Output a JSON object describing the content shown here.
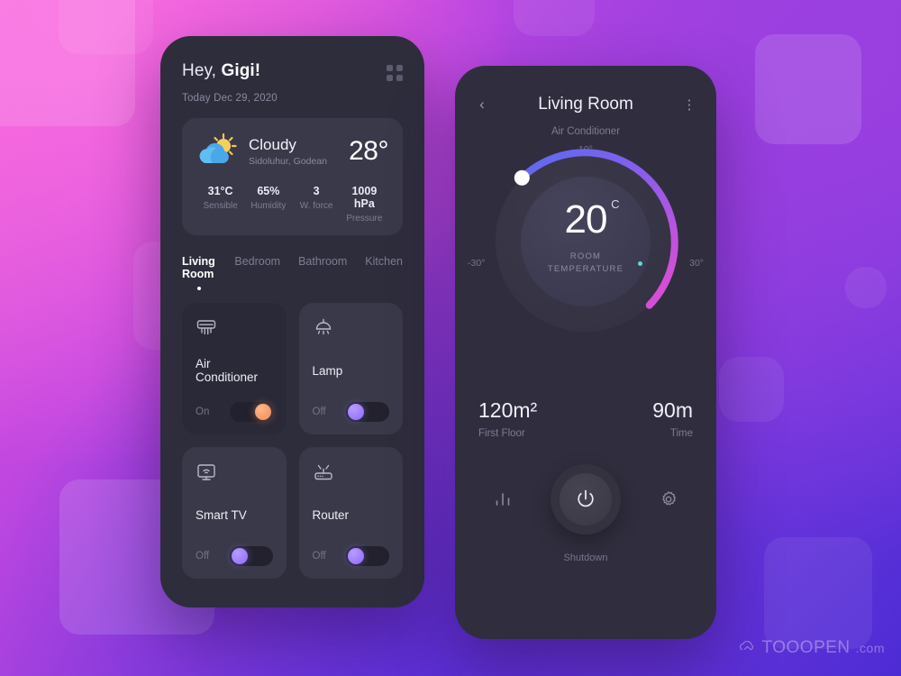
{
  "background": {
    "gradient_from": "#f368d8",
    "gradient_to": "#4b2bd4"
  },
  "left_phone": {
    "greeting_prefix": "Hey, ",
    "greeting_name": "Gigi!",
    "date": "Today Dec 29, 2020",
    "grid_icon": "grid-icon",
    "weather": {
      "icon": "sun-behind-cloud-icon",
      "condition": "Cloudy",
      "location": "Sidoluhur, Godean",
      "temperature": "28°",
      "stats": [
        {
          "value": "31°C",
          "label": "Sensible"
        },
        {
          "value": "65%",
          "label": "Humidity"
        },
        {
          "value": "3",
          "label": "W. force"
        },
        {
          "value": "1009 hPa",
          "label": "Pressure"
        }
      ]
    },
    "tabs": [
      {
        "label": "Living Room",
        "active": true
      },
      {
        "label": "Bedroom",
        "active": false
      },
      {
        "label": "Bathroom",
        "active": false
      },
      {
        "label": "Kitchen",
        "active": false
      }
    ],
    "devices": [
      {
        "name": "Air Conditioner",
        "state": "On",
        "icon": "air-conditioner-icon",
        "toggle": "on",
        "knob_color": "#f08a5d"
      },
      {
        "name": "Lamp",
        "state": "Off",
        "icon": "pendant-lamp-icon",
        "toggle": "off",
        "knob_color": "#8c6bf5"
      },
      {
        "name": "Smart TV",
        "state": "Off",
        "icon": "smart-tv-icon",
        "toggle": "off",
        "knob_color": "#8c6bf5"
      },
      {
        "name": "Router",
        "state": "Off",
        "icon": "router-icon",
        "toggle": "off",
        "knob_color": "#8c6bf5"
      }
    ]
  },
  "right_phone": {
    "back_icon": "chevron-left-icon",
    "title": "Living Room",
    "menu_icon": "kebab-menu-icon",
    "subtitle": "Air Conditioner",
    "dial": {
      "top_label": "10°",
      "min_label": "-30°",
      "max_label": "30°",
      "value": "20",
      "unit": "C",
      "caption_line1": "ROOM",
      "caption_line2": "TEMPERATURE",
      "arc_start_color": "#5b6cf5",
      "arc_end_color": "#d84fd8",
      "knob_color": "#ffffff"
    },
    "stats": [
      {
        "value": "120m²",
        "label": "First Floor"
      },
      {
        "value": "90m",
        "label": "Time"
      }
    ],
    "bottom_bar": {
      "stats_icon": "bar-chart-icon",
      "power_icon": "power-icon",
      "power_label": "Shutdown",
      "settings_icon": "gear-icon"
    }
  },
  "watermark": {
    "icon": "cloud-home-icon",
    "text_main": "TOOOPEN",
    "text_suffix": ".com"
  }
}
